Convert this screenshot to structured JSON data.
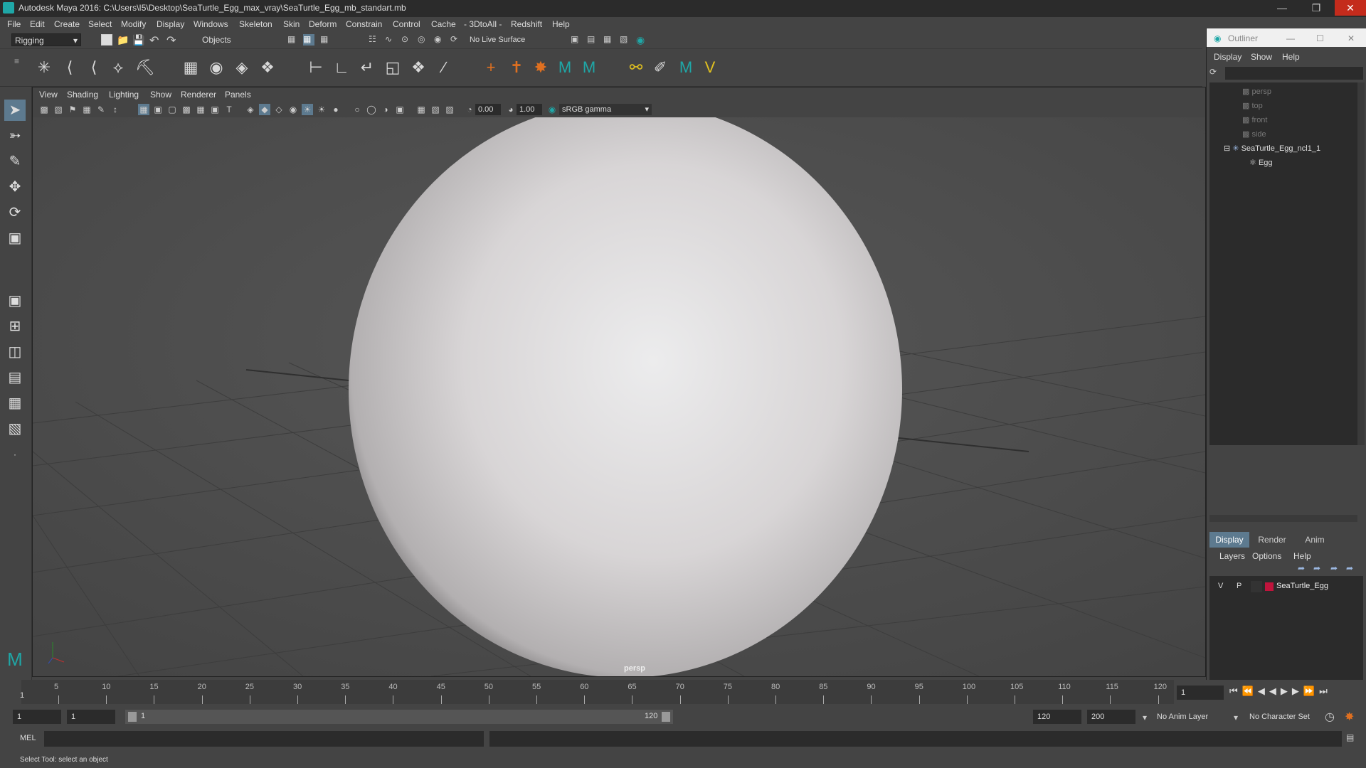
{
  "window": {
    "title": "Autodesk Maya 2016: C:\\Users\\I5\\Desktop\\SeaTurtle_Egg_max_vray\\SeaTurtle_Egg_mb_standart.mb"
  },
  "menubar": [
    "File",
    "Edit",
    "Create",
    "Select",
    "Modify",
    "Display",
    "Windows",
    "Skeleton",
    "Skin",
    "Deform",
    "Constrain",
    "Control",
    "Cache",
    "- 3DtoAll -",
    "Redshift",
    "Help"
  ],
  "statusline": {
    "mode": "Rigging",
    "selection_mode": "Objects",
    "live_surface": "No Live Surface"
  },
  "viewport": {
    "menu": [
      "View",
      "Shading",
      "Lighting",
      "Show",
      "Renderer",
      "Panels"
    ],
    "exposure": "0.00",
    "gamma": "1.00",
    "color_space": "sRGB gamma",
    "camera": "persp"
  },
  "outliner": {
    "title": "Outliner",
    "menu": [
      "Display",
      "Show",
      "Help"
    ],
    "items": [
      {
        "label": "persp",
        "type": "camera"
      },
      {
        "label": "top",
        "type": "camera"
      },
      {
        "label": "front",
        "type": "camera"
      },
      {
        "label": "side",
        "type": "camera"
      },
      {
        "label": "SeaTurtle_Egg_ncl1_1",
        "type": "group"
      },
      {
        "label": "Egg",
        "type": "mesh"
      }
    ]
  },
  "layers": {
    "tabs": [
      "Display",
      "Render",
      "Anim"
    ],
    "active_tab": "Display",
    "menu": [
      "Layers",
      "Options",
      "Help"
    ],
    "rows": [
      {
        "v": "V",
        "p": "P",
        "name": "SeaTurtle_Egg",
        "color": "#c0143c"
      }
    ]
  },
  "timeline": {
    "ticks": [
      "5",
      "10",
      "15",
      "20",
      "25",
      "30",
      "35",
      "40",
      "45",
      "50",
      "55",
      "60",
      "65",
      "70",
      "75",
      "80",
      "85",
      "90",
      "95",
      "100",
      "105",
      "110",
      "115",
      "120"
    ],
    "start_label": "1",
    "current_frame": "1"
  },
  "range": {
    "start": "1",
    "playback_start": "1",
    "slider_start": "1",
    "slider_end": "120",
    "playback_end": "120",
    "end": "200",
    "anim_layer": "No Anim Layer",
    "character_set": "No Character Set"
  },
  "command": {
    "label": "MEL"
  },
  "help_line": "Select Tool: select an object",
  "colors": {
    "accent": "#5d7a8f",
    "maya_teal": "#1fa7a7",
    "close_red": "#c42b1c"
  }
}
